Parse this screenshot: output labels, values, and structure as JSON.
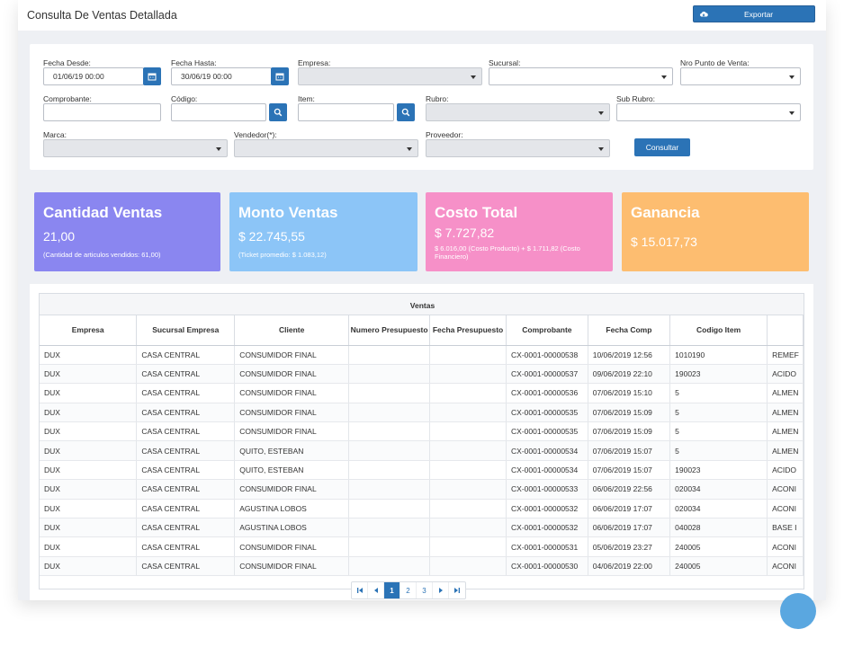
{
  "header": {
    "title": "Consulta De Ventas Detallada",
    "export_label": "Exportar",
    "export_icon": "cloud-download-icon"
  },
  "filters": {
    "fecha_desde": {
      "label": "Fecha Desde:",
      "value": "01/06/19 00:00"
    },
    "fecha_hasta": {
      "label": "Fecha Hasta:",
      "value": "30/06/19 00:00"
    },
    "empresa": {
      "label": "Empresa:",
      "value": ""
    },
    "sucursal": {
      "label": "Sucursal:",
      "value": ""
    },
    "nro_punto_venta": {
      "label": "Nro Punto de Venta:",
      "value": ""
    },
    "comprobante": {
      "label": "Comprobante:",
      "value": ""
    },
    "codigo": {
      "label": "Código:",
      "value": ""
    },
    "item": {
      "label": "Item:",
      "value": ""
    },
    "rubro": {
      "label": "Rubro:",
      "value": ""
    },
    "sub_rubro": {
      "label": "Sub Rubro:",
      "value": ""
    },
    "marca": {
      "label": "Marca:",
      "value": ""
    },
    "vendedor": {
      "label": "Vendedor(*):",
      "value": ""
    },
    "proveedor": {
      "label": "Proveedor:",
      "value": ""
    },
    "consultar_label": "Consultar"
  },
  "cards": [
    {
      "title": "Cantidad Ventas",
      "value": "21,00",
      "sub": "(Cantidad de articulos vendidos: 61,00)",
      "color": "#8a86f0"
    },
    {
      "title": "Monto Ventas",
      "value": "$ 22.745,55",
      "sub": "(Ticket promedio: $ 1.083,12)",
      "color": "#8cc5f7"
    },
    {
      "title": "Costo Total",
      "value": "$ 7.727,82",
      "sub": "$ 6.016,00 (Costo Producto) + $ 1.711,82 (Costo Financiero)",
      "color": "#f690c8"
    },
    {
      "title": "Ganancia",
      "value": "$ 15.017,73",
      "sub": "",
      "color": "#fdbd70"
    }
  ],
  "table": {
    "caption": "Ventas",
    "columns": [
      "Empresa",
      "Sucursal Empresa",
      "Cliente",
      "Numero Presupuesto",
      "Fecha Presupuesto",
      "Comprobante",
      "Fecha Comp",
      "Codigo Item",
      ""
    ],
    "rows": [
      [
        "DUX",
        "CASA CENTRAL",
        "CONSUMIDOR FINAL",
        "",
        "",
        "CX-0001-00000538",
        "10/06/2019 12:56",
        "1010190",
        "REMEF"
      ],
      [
        "DUX",
        "CASA CENTRAL",
        "CONSUMIDOR FINAL",
        "",
        "",
        "CX-0001-00000537",
        "09/06/2019 22:10",
        "190023",
        "ACIDO"
      ],
      [
        "DUX",
        "CASA CENTRAL",
        "CONSUMIDOR FINAL",
        "",
        "",
        "CX-0001-00000536",
        "07/06/2019 15:10",
        "5",
        "ALMEN"
      ],
      [
        "DUX",
        "CASA CENTRAL",
        "CONSUMIDOR FINAL",
        "",
        "",
        "CX-0001-00000535",
        "07/06/2019 15:09",
        "5",
        "ALMEN"
      ],
      [
        "DUX",
        "CASA CENTRAL",
        "CONSUMIDOR FINAL",
        "",
        "",
        "CX-0001-00000535",
        "07/06/2019 15:09",
        "5",
        "ALMEN"
      ],
      [
        "DUX",
        "CASA CENTRAL",
        "QUITO, ESTEBAN",
        "",
        "",
        "CX-0001-00000534",
        "07/06/2019 15:07",
        "5",
        "ALMEN"
      ],
      [
        "DUX",
        "CASA CENTRAL",
        "QUITO, ESTEBAN",
        "",
        "",
        "CX-0001-00000534",
        "07/06/2019 15:07",
        "190023",
        "ACIDO"
      ],
      [
        "DUX",
        "CASA CENTRAL",
        "CONSUMIDOR FINAL",
        "",
        "",
        "CX-0001-00000533",
        "06/06/2019 22:56",
        "020034",
        "ACONI"
      ],
      [
        "DUX",
        "CASA CENTRAL",
        "AGUSTINA LOBOS",
        "",
        "",
        "CX-0001-00000532",
        "06/06/2019 17:07",
        "020034",
        "ACONI"
      ],
      [
        "DUX",
        "CASA CENTRAL",
        "AGUSTINA LOBOS",
        "",
        "",
        "CX-0001-00000532",
        "06/06/2019 17:07",
        "040028",
        "BASE I"
      ],
      [
        "DUX",
        "CASA CENTRAL",
        "CONSUMIDOR FINAL",
        "",
        "",
        "CX-0001-00000531",
        "05/06/2019 23:27",
        "240005",
        "ACONI"
      ],
      [
        "DUX",
        "CASA CENTRAL",
        "CONSUMIDOR FINAL",
        "",
        "",
        "CX-0001-00000530",
        "04/06/2019 22:00",
        "240005",
        "ACONI"
      ]
    ]
  },
  "pager": {
    "first": "first-page-icon",
    "prev": "prev-page-icon",
    "next": "next-page-icon",
    "last": "last-page-icon",
    "pages": [
      "1",
      "2",
      "3"
    ],
    "current": "1"
  },
  "colors": {
    "primary": "#2b73b6"
  }
}
